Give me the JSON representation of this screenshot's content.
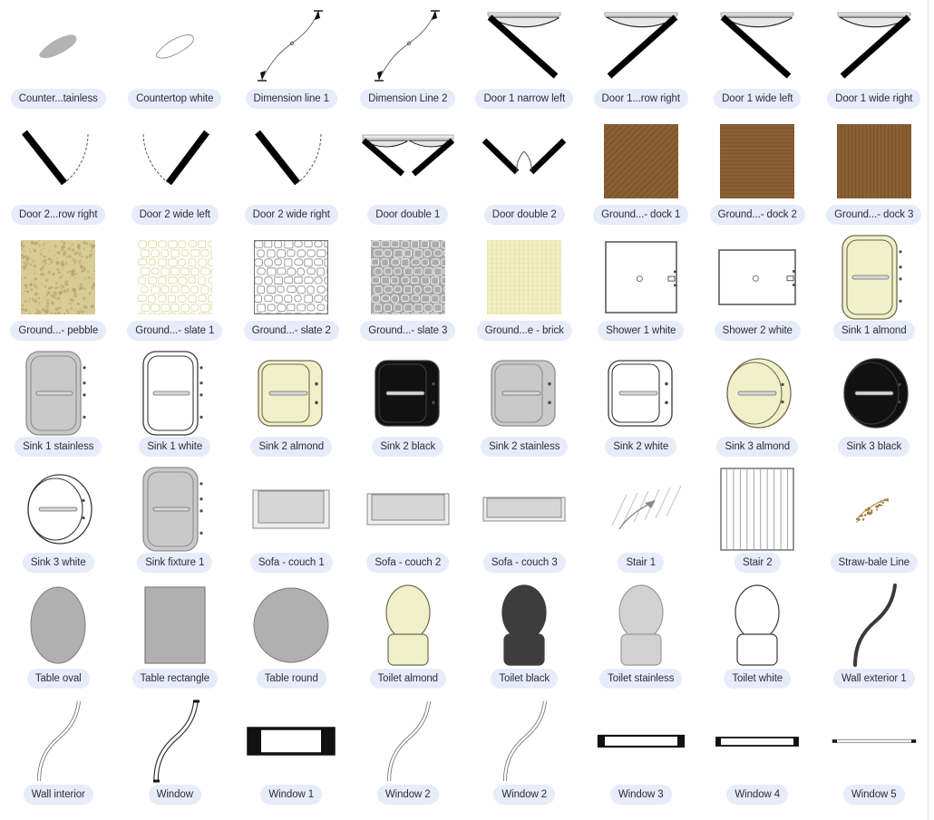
{
  "app": {
    "title": "Architectural Symbol Library",
    "view": "grid",
    "columns": 8,
    "rows": 7,
    "item_count": 56
  },
  "colors": {
    "label_bg": "#e6ecfa",
    "label_text": "#2b2f36",
    "canvas_bg": "#ffffff",
    "stroke": "#3a3a3a",
    "fill_stainless": "#c9c9c9",
    "fill_almond": "#f2f0c8",
    "fill_black": "#111111",
    "fill_white": "#ffffff",
    "fill_wood": "#8a5f34",
    "fill_pebble": "#d9cb96",
    "fill_slate_yellow": "#e8e3b4",
    "fill_slate_gray": "#a8a8a8",
    "fill_brick": "#f2f0c2",
    "fill_table": "#b0b0b0",
    "divider": "#e2e2e4"
  },
  "items": [
    {
      "label": "Counter...tainless",
      "full_label": "Countertop stainless",
      "icon": "countertop-stainless-icon",
      "kind": "blob",
      "fill": "#b3b3b3",
      "stroke": "none"
    },
    {
      "label": "Countertop white",
      "full_label": "Countertop white",
      "icon": "countertop-white-icon",
      "kind": "blob",
      "fill": "#ffffff",
      "stroke": "#9a9a9a"
    },
    {
      "label": "Dimension line 1",
      "full_label": "Dimension line 1",
      "icon": "dimension-line-1-icon",
      "kind": "dimension",
      "fill": "none",
      "stroke": "#555555"
    },
    {
      "label": "Dimension Line 2",
      "full_label": "Dimension Line 2",
      "icon": "dimension-line-2-icon",
      "kind": "dimension",
      "fill": "none",
      "stroke": "#555555"
    },
    {
      "label": "Door 1 narrow left",
      "full_label": "Door 1 narrow left",
      "icon": "door-1-narrow-left-icon",
      "kind": "door-swing",
      "variant": "narrow-left"
    },
    {
      "label": "Door 1...row right",
      "full_label": "Door 1 narrow right",
      "icon": "door-1-narrow-right-icon",
      "kind": "door-swing",
      "variant": "narrow-right"
    },
    {
      "label": "Door 1 wide left",
      "full_label": "Door 1 wide left",
      "icon": "door-1-wide-left-icon",
      "kind": "door-swing",
      "variant": "wide-left"
    },
    {
      "label": "Door 1 wide right",
      "full_label": "Door 1 wide right",
      "icon": "door-1-wide-right-icon",
      "kind": "door-swing",
      "variant": "wide-right"
    },
    {
      "label": "Door 2...row right",
      "full_label": "Door 2 narrow right",
      "icon": "door-2-narrow-right-icon",
      "kind": "door-open",
      "variant": "narrow-right"
    },
    {
      "label": "Door 2 wide left",
      "full_label": "Door 2 wide left",
      "icon": "door-2-wide-left-icon",
      "kind": "door-open",
      "variant": "wide-left"
    },
    {
      "label": "Door 2 wide right",
      "full_label": "Door 2 wide right",
      "icon": "door-2-wide-right-icon",
      "kind": "door-open",
      "variant": "wide-right"
    },
    {
      "label": "Door double 1",
      "full_label": "Door double 1",
      "icon": "door-double-1-icon",
      "kind": "door-double",
      "variant": "filled"
    },
    {
      "label": "Door double 2",
      "full_label": "Door double 2",
      "icon": "door-double-2-icon",
      "kind": "door-double",
      "variant": "open"
    },
    {
      "label": "Ground...- dock 1",
      "full_label": "Ground cover - dock 1",
      "icon": "ground-dock-1-icon",
      "kind": "swatch",
      "pattern": "diagonal",
      "fill": "#8a5f34"
    },
    {
      "label": "Ground...- dock 2",
      "full_label": "Ground cover - dock 2",
      "icon": "ground-dock-2-icon",
      "kind": "swatch",
      "pattern": "horizontal",
      "fill": "#8a5f34"
    },
    {
      "label": "Ground...- dock 3",
      "full_label": "Ground cover - dock 3",
      "icon": "ground-dock-3-icon",
      "kind": "swatch",
      "pattern": "vertical",
      "fill": "#8a5f34"
    },
    {
      "label": "Ground...- pebble",
      "full_label": "Ground cover - pebble",
      "icon": "ground-pebble-icon",
      "kind": "swatch",
      "pattern": "pebble",
      "fill": "#d9cb96"
    },
    {
      "label": "Ground...- slate 1",
      "full_label": "Ground cover - slate 1",
      "icon": "ground-slate-1-icon",
      "kind": "swatch",
      "pattern": "stone",
      "fill": "#ffffff",
      "stroke": "#ddd79f"
    },
    {
      "label": "Ground...- slate 2",
      "full_label": "Ground cover - slate 2",
      "icon": "ground-slate-2-icon",
      "kind": "swatch",
      "pattern": "stone",
      "fill": "#ffffff",
      "stroke": "#8d8d8d"
    },
    {
      "label": "Ground...- slate 3",
      "full_label": "Ground cover - slate 3",
      "icon": "ground-slate-3-icon",
      "kind": "swatch",
      "pattern": "stone",
      "fill": "#a8a8a8",
      "stroke": "#ffffff"
    },
    {
      "label": "Ground...e - brick",
      "full_label": "Ground surface - brick",
      "icon": "ground-brick-icon",
      "kind": "swatch",
      "pattern": "grid",
      "fill": "#f2f0c2"
    },
    {
      "label": "Shower 1 white",
      "full_label": "Shower 1 white",
      "icon": "shower-1-white-icon",
      "kind": "shower",
      "variant": "square"
    },
    {
      "label": "Shower 2 white",
      "full_label": "Shower 2 white",
      "icon": "shower-2-white-icon",
      "kind": "shower",
      "variant": "wide"
    },
    {
      "label": "Sink 1 almond",
      "full_label": "Sink 1 almond",
      "icon": "sink-1-almond-icon",
      "kind": "sink1",
      "fill": "#f2f0c8",
      "stroke": "#6d6d52"
    },
    {
      "label": "Sink 1 stainless",
      "full_label": "Sink 1 stainless",
      "icon": "sink-1-stainless-icon",
      "kind": "sink1",
      "fill": "#c9c9c9",
      "stroke": "#8d8d8d"
    },
    {
      "label": "Sink 1 white",
      "full_label": "Sink 1 white",
      "icon": "sink-1-white-icon",
      "kind": "sink1",
      "fill": "#ffffff",
      "stroke": "#3a3a3a"
    },
    {
      "label": "Sink 2 almond",
      "full_label": "Sink 2 almond",
      "icon": "sink-2-almond-icon",
      "kind": "sink2",
      "fill": "#f2f0c8",
      "stroke": "#6d6d52"
    },
    {
      "label": "Sink 2 black",
      "full_label": "Sink 2 black",
      "icon": "sink-2-black-icon",
      "kind": "sink2",
      "fill": "#111111",
      "stroke": "#3d3d3d"
    },
    {
      "label": "Sink 2 stainless",
      "full_label": "Sink 2 stainless",
      "icon": "sink-2-stainless-icon",
      "kind": "sink2",
      "fill": "#c9c9c9",
      "stroke": "#8d8d8d"
    },
    {
      "label": "Sink 2 white",
      "full_label": "Sink 2 white",
      "icon": "sink-2-white-icon",
      "kind": "sink2",
      "fill": "#ffffff",
      "stroke": "#3a3a3a"
    },
    {
      "label": "Sink 3 almond",
      "full_label": "Sink 3 almond",
      "icon": "sink-3-almond-icon",
      "kind": "sink3",
      "fill": "#f2f0c8",
      "stroke": "#6d6d52"
    },
    {
      "label": "Sink 3 black",
      "full_label": "Sink 3 black",
      "icon": "sink-3-black-icon",
      "kind": "sink3",
      "fill": "#111111",
      "stroke": "#3d3d3d"
    },
    {
      "label": "Sink 3 white",
      "full_label": "Sink 3 white",
      "icon": "sink-3-white-icon",
      "kind": "sink3",
      "fill": "#ffffff",
      "stroke": "#3a3a3a"
    },
    {
      "label": "Sink fixture 1",
      "full_label": "Sink fixture 1",
      "icon": "sink-fixture-1-icon",
      "kind": "sink1",
      "fill": "#c9c9c9",
      "stroke": "#8d8d8d"
    },
    {
      "label": "Sofa - couch 1",
      "full_label": "Sofa - couch 1",
      "icon": "sofa-couch-1-icon",
      "kind": "sofa",
      "variant": "deep"
    },
    {
      "label": "Sofa - couch 2",
      "full_label": "Sofa - couch 2",
      "icon": "sofa-couch-2-icon",
      "kind": "sofa",
      "variant": "mid"
    },
    {
      "label": "Sofa - couch 3",
      "full_label": "Sofa - couch 3",
      "icon": "sofa-couch-3-icon",
      "kind": "sofa",
      "variant": "shallow"
    },
    {
      "label": "Stair 1",
      "full_label": "Stair 1",
      "icon": "stair-1-icon",
      "kind": "stair",
      "variant": "arrow"
    },
    {
      "label": "Stair 2",
      "full_label": "Stair 2",
      "icon": "stair-2-icon",
      "kind": "stair",
      "variant": "treads"
    },
    {
      "label": "Straw-bale Line",
      "full_label": "Straw-bale Line",
      "icon": "straw-bale-line-icon",
      "kind": "straw"
    },
    {
      "label": "Table oval",
      "full_label": "Table oval",
      "icon": "table-oval-icon",
      "kind": "table",
      "variant": "oval",
      "fill": "#b0b0b0"
    },
    {
      "label": "Table rectangle",
      "full_label": "Table rectangle",
      "icon": "table-rectangle-icon",
      "kind": "table",
      "variant": "rect",
      "fill": "#b0b0b0"
    },
    {
      "label": "Table round",
      "full_label": "Table round",
      "icon": "table-round-icon",
      "kind": "table",
      "variant": "round",
      "fill": "#b0b0b0"
    },
    {
      "label": "Toilet almond",
      "full_label": "Toilet almond",
      "icon": "toilet-almond-icon",
      "kind": "toilet",
      "fill": "#f2f0c8",
      "stroke": "#6d6d52"
    },
    {
      "label": "Toilet black",
      "full_label": "Toilet black",
      "icon": "toilet-black-icon",
      "kind": "toilet",
      "fill": "#3d3d3d",
      "stroke": "#3d3d3d"
    },
    {
      "label": "Toilet stainless",
      "full_label": "Toilet stainless",
      "icon": "toilet-stainless-icon",
      "kind": "toilet",
      "fill": "#d2d2d2",
      "stroke": "#9a9a9a"
    },
    {
      "label": "Toilet white",
      "full_label": "Toilet white",
      "icon": "toilet-white-icon",
      "kind": "toilet",
      "fill": "#ffffff",
      "stroke": "#3a3a3a"
    },
    {
      "label": "Wall exterior 1",
      "full_label": "Wall exterior 1",
      "icon": "wall-exterior-1-icon",
      "kind": "curve",
      "variant": "thick",
      "stroke": "#3a3a3a"
    },
    {
      "label": "Wall interior",
      "full_label": "Wall interior",
      "icon": "wall-interior-icon",
      "kind": "curve",
      "variant": "double-thin",
      "stroke": "#6e6e6e"
    },
    {
      "label": "Window",
      "full_label": "Window",
      "icon": "window-icon",
      "kind": "curve",
      "variant": "double-cap",
      "stroke": "#3a3a3a"
    },
    {
      "label": "Window 1",
      "full_label": "Window 1",
      "icon": "window-1-icon",
      "kind": "window-bar",
      "variant": "thick"
    },
    {
      "label": "Window 2",
      "full_label": "Window 2",
      "icon": "window-2-icon",
      "kind": "curve",
      "variant": "double-thin",
      "stroke": "#6e6e6e"
    },
    {
      "label": "Window 2",
      "full_label": "Window 2",
      "icon": "window-2-alt-icon",
      "kind": "curve",
      "variant": "double-thin",
      "stroke": "#6e6e6e"
    },
    {
      "label": "Window 3",
      "full_label": "Window 3",
      "icon": "window-3-icon",
      "kind": "window-bar",
      "variant": "medium"
    },
    {
      "label": "Window 4",
      "full_label": "Window 4",
      "icon": "window-4-icon",
      "kind": "window-bar",
      "variant": "thin"
    },
    {
      "label": "Window 5",
      "full_label": "Window 5",
      "icon": "window-5-icon",
      "kind": "window-bar",
      "variant": "hairline"
    }
  ]
}
